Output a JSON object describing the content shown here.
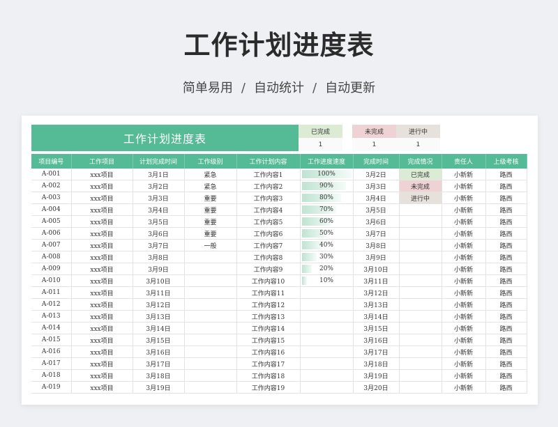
{
  "hero": {
    "title": "工作计划进度表",
    "tags": [
      "简单易用",
      "自动统计",
      "自动更新"
    ],
    "separator": "/"
  },
  "sheet": {
    "title": "工作计划进度表",
    "stats": {
      "done": {
        "label": "已完成",
        "value": "1"
      },
      "todo": {
        "label": "未完成",
        "value": "1"
      },
      "prog": {
        "label": "进行中",
        "value": "1"
      }
    },
    "columns": [
      "项目编号",
      "工作项目",
      "计划完成时间",
      "工作级别",
      "工作计划内容",
      "工作进度速度",
      "完成时间",
      "完成情况",
      "责任人",
      "上级考核"
    ],
    "rows": [
      {
        "id": "A-001",
        "item": "xxx项目",
        "plan": "3月1日",
        "level": "紧急",
        "content": "工作内容1",
        "progress": "100%",
        "finish": "3月2日",
        "status": "已完成",
        "owner": "小新新",
        "reviewer": "路西"
      },
      {
        "id": "A-002",
        "item": "xxx项目",
        "plan": "3月2日",
        "level": "紧急",
        "content": "工作内容2",
        "progress": "90%",
        "finish": "3月3日",
        "status": "未完成",
        "owner": "小新新",
        "reviewer": "路西"
      },
      {
        "id": "A-003",
        "item": "xxx项目",
        "plan": "3月3日",
        "level": "重要",
        "content": "工作内容3",
        "progress": "80%",
        "finish": "3月4日",
        "status": "进行中",
        "owner": "小新新",
        "reviewer": "路西"
      },
      {
        "id": "A-004",
        "item": "xxx项目",
        "plan": "3月4日",
        "level": "重要",
        "content": "工作内容4",
        "progress": "70%",
        "finish": "3月5日",
        "status": "",
        "owner": "小新新",
        "reviewer": "路西"
      },
      {
        "id": "A-005",
        "item": "xxx项目",
        "plan": "3月5日",
        "level": "重要",
        "content": "工作内容5",
        "progress": "60%",
        "finish": "3月6日",
        "status": "",
        "owner": "小新新",
        "reviewer": "路西"
      },
      {
        "id": "A-006",
        "item": "xxx项目",
        "plan": "3月6日",
        "level": "重要",
        "content": "工作内容6",
        "progress": "50%",
        "finish": "3月7日",
        "status": "",
        "owner": "小新新",
        "reviewer": "路西"
      },
      {
        "id": "A-007",
        "item": "xxx项目",
        "plan": "3月7日",
        "level": "一般",
        "content": "工作内容7",
        "progress": "40%",
        "finish": "3月8日",
        "status": "",
        "owner": "小新新",
        "reviewer": "路西"
      },
      {
        "id": "A-008",
        "item": "xxx项目",
        "plan": "3月8日",
        "level": "",
        "content": "工作内容8",
        "progress": "30%",
        "finish": "3月9日",
        "status": "",
        "owner": "小新新",
        "reviewer": "路西"
      },
      {
        "id": "A-009",
        "item": "xxx项目",
        "plan": "3月9日",
        "level": "",
        "content": "工作内容9",
        "progress": "20%",
        "finish": "3月10日",
        "status": "",
        "owner": "小新新",
        "reviewer": "路西"
      },
      {
        "id": "A-010",
        "item": "xxx项目",
        "plan": "3月10日",
        "level": "",
        "content": "工作内容10",
        "progress": "10%",
        "finish": "3月11日",
        "status": "",
        "owner": "小新新",
        "reviewer": "路西"
      },
      {
        "id": "A-011",
        "item": "xxx项目",
        "plan": "3月11日",
        "level": "",
        "content": "工作内容11",
        "progress": "",
        "finish": "3月12日",
        "status": "",
        "owner": "小新新",
        "reviewer": "路西"
      },
      {
        "id": "A-012",
        "item": "xxx项目",
        "plan": "3月12日",
        "level": "",
        "content": "工作内容12",
        "progress": "",
        "finish": "3月13日",
        "status": "",
        "owner": "小新新",
        "reviewer": "路西"
      },
      {
        "id": "A-013",
        "item": "xxx项目",
        "plan": "3月13日",
        "level": "",
        "content": "工作内容13",
        "progress": "",
        "finish": "3月14日",
        "status": "",
        "owner": "小新新",
        "reviewer": "路西"
      },
      {
        "id": "A-014",
        "item": "xxx项目",
        "plan": "3月14日",
        "level": "",
        "content": "工作内容14",
        "progress": "",
        "finish": "3月15日",
        "status": "",
        "owner": "小新新",
        "reviewer": "路西"
      },
      {
        "id": "A-015",
        "item": "xxx项目",
        "plan": "3月15日",
        "level": "",
        "content": "工作内容15",
        "progress": "",
        "finish": "3月16日",
        "status": "",
        "owner": "小新新",
        "reviewer": "路西"
      },
      {
        "id": "A-016",
        "item": "xxx项目",
        "plan": "3月16日",
        "level": "",
        "content": "工作内容16",
        "progress": "",
        "finish": "3月17日",
        "status": "",
        "owner": "小新新",
        "reviewer": "路西"
      },
      {
        "id": "A-017",
        "item": "xxx项目",
        "plan": "3月17日",
        "level": "",
        "content": "工作内容17",
        "progress": "",
        "finish": "3月18日",
        "status": "",
        "owner": "小新新",
        "reviewer": "路西"
      },
      {
        "id": "A-018",
        "item": "xxx项目",
        "plan": "3月18日",
        "level": "",
        "content": "工作内容18",
        "progress": "",
        "finish": "3月19日",
        "status": "",
        "owner": "小新新",
        "reviewer": "路西"
      },
      {
        "id": "A-019",
        "item": "xxx项目",
        "plan": "3月19日",
        "level": "",
        "content": "工作内容19",
        "progress": "",
        "finish": "3月20日",
        "status": "",
        "owner": "小新新",
        "reviewer": "路西"
      }
    ]
  }
}
